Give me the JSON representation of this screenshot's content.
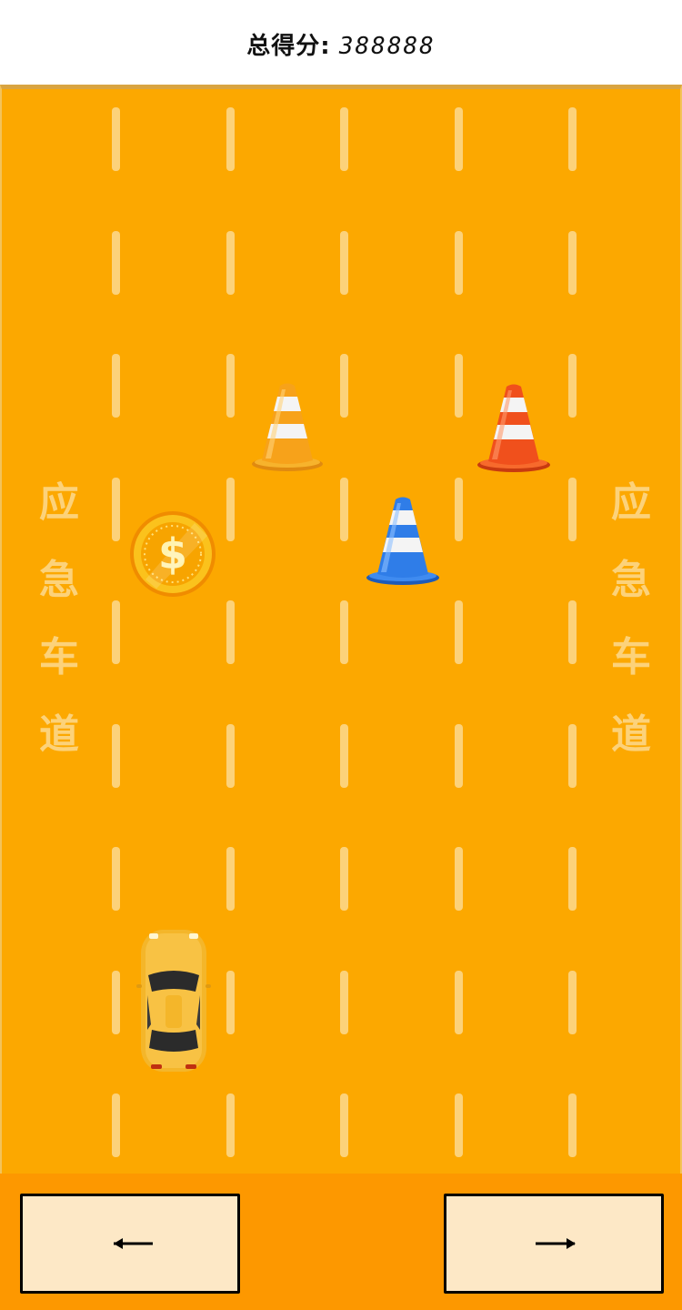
{
  "header": {
    "score_label": "总得分:",
    "score_value": "388888"
  },
  "side_lane_label": [
    "应",
    "急",
    "车",
    "道"
  ],
  "obstacles": [
    {
      "icon": "orange-traffic-cone-icon",
      "color": "#f7a21a"
    },
    {
      "icon": "red-traffic-cone-icon",
      "color": "#f0501c"
    },
    {
      "icon": "blue-traffic-cone-icon",
      "color": "#2f7de8"
    }
  ],
  "collectibles": [
    {
      "icon": "gold-dollar-coin-icon",
      "symbol": "$",
      "color": "#f8c21a"
    }
  ],
  "player": {
    "icon": "yellow-taxi-car-icon",
    "color": "#f4b62a"
  },
  "controls": {
    "left_label": "←",
    "right_label": "→"
  },
  "colors": {
    "road": "#fca800",
    "lane_marking": "#fcd27a",
    "control_bar": "#fd9800",
    "button_fill": "#fde8c6"
  }
}
